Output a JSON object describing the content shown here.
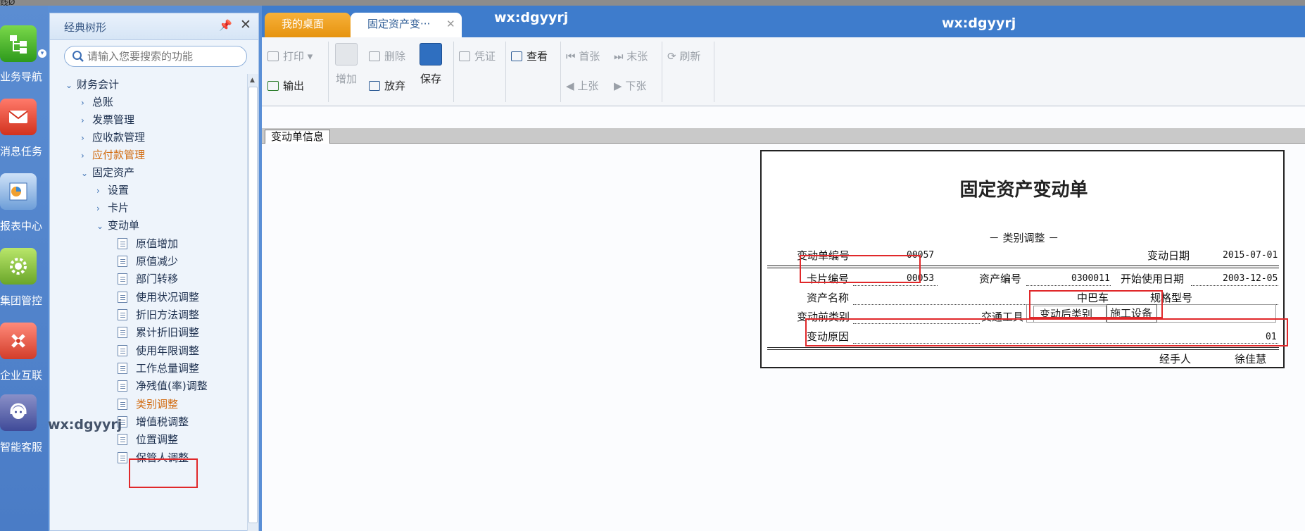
{
  "app": {
    "top_logo": "线Ø"
  },
  "rail": {
    "items": [
      {
        "label": "业务导航",
        "icon": "tree-nav-icon"
      },
      {
        "label": "消息任务",
        "icon": "mail-icon"
      },
      {
        "label": "报表中心",
        "icon": "report-icon"
      },
      {
        "label": "集团管控",
        "icon": "gear-icon"
      },
      {
        "label": "企业互联",
        "icon": "link-icon"
      },
      {
        "label": "智能客服",
        "icon": "headset-icon"
      }
    ]
  },
  "tree_panel": {
    "title": "经典树形",
    "search_placeholder": "请输入您要搜索的功能",
    "nodes": [
      {
        "label": "财务会计",
        "level": 0,
        "expanded": true
      },
      {
        "label": "总账",
        "level": 1
      },
      {
        "label": "发票管理",
        "level": 1
      },
      {
        "label": "应收款管理",
        "level": 1
      },
      {
        "label": "应付款管理",
        "level": 1,
        "highlight": true
      },
      {
        "label": "固定资产",
        "level": 1,
        "expanded": true
      },
      {
        "label": "设置",
        "level": 2
      },
      {
        "label": "卡片",
        "level": 2
      },
      {
        "label": "变动单",
        "level": 2,
        "expanded": true
      },
      {
        "label": "原值增加",
        "level": 3
      },
      {
        "label": "原值减少",
        "level": 3
      },
      {
        "label": "部门转移",
        "level": 3
      },
      {
        "label": "使用状况调整",
        "level": 3
      },
      {
        "label": "折旧方法调整",
        "level": 3
      },
      {
        "label": "累计折旧调整",
        "level": 3
      },
      {
        "label": "使用年限调整",
        "level": 3
      },
      {
        "label": "工作总量调整",
        "level": 3
      },
      {
        "label": "净残值(率)调整",
        "level": 3
      },
      {
        "label": "类别调整",
        "level": 3,
        "selected": true
      },
      {
        "label": "增值税调整",
        "level": 3
      },
      {
        "label": "位置调整",
        "level": 3
      },
      {
        "label": "保管人调整",
        "level": 3
      }
    ]
  },
  "tabs": {
    "desk": "我的桌面",
    "active": "固定资产变···"
  },
  "watermark": "wx:dgyyrj",
  "toolbar": {
    "print": "打印",
    "export": "输出",
    "add": "增加",
    "delete": "删除",
    "discard": "放弃",
    "save": "保存",
    "voucher": "凭证",
    "view": "查看",
    "first": "首张",
    "last": "末张",
    "prev": "上张",
    "next": "下张",
    "refresh": "刷新"
  },
  "subtab": "变动单信息",
  "form": {
    "title": "固定资产变动单",
    "subtitle": "－ 类别调整 －",
    "change_no_label": "变动单编号",
    "change_no": "00057",
    "change_date_label": "变动日期",
    "change_date": "2015-07-01",
    "card_no_label": "卡片编号",
    "card_no": "00053",
    "asset_no_label": "资产编号",
    "asset_no": "0300011",
    "start_date_label": "开始使用日期",
    "start_date": "2003-12-05",
    "asset_name_label": "资产名称",
    "asset_name": "中巴车",
    "spec_label": "规格型号",
    "before_cat_label": "变动前类别",
    "before_cat": "交通工具",
    "after_cat_label": "变动后类别",
    "after_cat": "施工设备",
    "reason_label": "变动原因",
    "reason": "01",
    "handler_label": "经手人",
    "handler": "徐佳慧"
  },
  "colors": {
    "accent": "#3e7ccc",
    "highlight_red": "#e0282a",
    "tab_orange": "#e6930f"
  }
}
